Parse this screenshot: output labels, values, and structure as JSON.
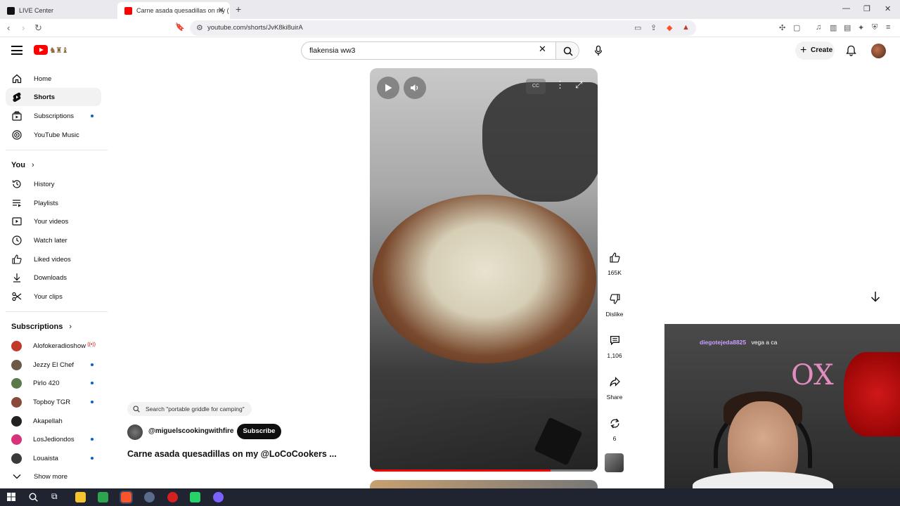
{
  "browser": {
    "tabs": [
      {
        "title": "LIVE Center",
        "active": false
      },
      {
        "title": "Carne asada quesadillas on my (",
        "active": true
      }
    ],
    "url": "youtube.com/shorts/JvK8ki8uirA"
  },
  "masthead": {
    "search_value": "flakensia ww3",
    "create_label": "Create"
  },
  "sidebar": {
    "main": [
      {
        "label": "Home",
        "icon": "home-icon"
      },
      {
        "label": "Shorts",
        "icon": "shorts-icon",
        "active": true
      },
      {
        "label": "Subscriptions",
        "icon": "subscriptions-icon",
        "dot": true
      },
      {
        "label": "YouTube Music",
        "icon": "youtube-music-icon"
      }
    ],
    "you_heading": "You",
    "you": [
      {
        "label": "History",
        "icon": "history-icon"
      },
      {
        "label": "Playlists",
        "icon": "playlists-icon"
      },
      {
        "label": "Your videos",
        "icon": "your-videos-icon"
      },
      {
        "label": "Watch later",
        "icon": "watch-later-icon"
      },
      {
        "label": "Liked videos",
        "icon": "liked-videos-icon"
      },
      {
        "label": "Downloads",
        "icon": "downloads-icon"
      },
      {
        "label": "Your clips",
        "icon": "scissors-icon"
      }
    ],
    "subscriptions_heading": "Subscriptions",
    "subscriptions": [
      {
        "label": "Alofokeradioshow",
        "live": "((•))",
        "color": "#c0392b"
      },
      {
        "label": "Jezzy El Chef",
        "dot": true,
        "color": "#6b5a4a"
      },
      {
        "label": "Pirlo 420",
        "dot": true,
        "color": "#5a7a4a"
      },
      {
        "label": "Topboy TGR",
        "dot": true,
        "color": "#8a4a3a"
      },
      {
        "label": "Akapellah",
        "color": "#222222"
      },
      {
        "label": "LosJediondos",
        "dot": true,
        "color": "#d6337a"
      },
      {
        "label": "Louaista",
        "dot": true,
        "color": "#3a3a3a"
      }
    ],
    "show_more": "Show more"
  },
  "player": {
    "progress_fraction": 0.8
  },
  "overlay": {
    "related_search": "Search \"portable griddle for camping\"",
    "channel": "@miguelscookingwithfire",
    "subscribe": "Subscribe",
    "title": "Carne asada quesadillas on my @LoCoCookers ..."
  },
  "actions": {
    "likes": "165K",
    "dislike": "Dislike",
    "comments": "1,106",
    "share": "Share",
    "remix": "6"
  },
  "webcam": {
    "chat_user": "diegotejeda8825",
    "chat_text": "vega a ca"
  }
}
